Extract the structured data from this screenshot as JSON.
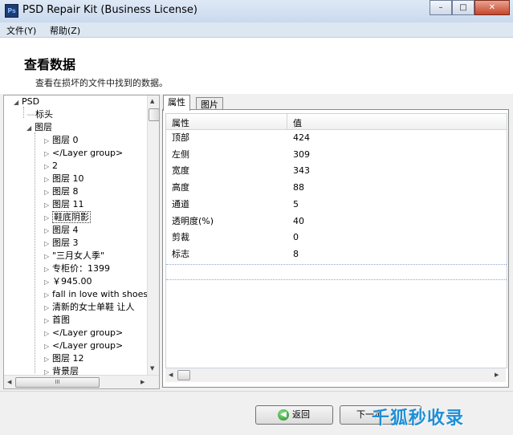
{
  "window": {
    "title": "PSD Repair Kit (Business License)",
    "app_icon_text": "Ps",
    "minimize_glyph": "–",
    "maximize_glyph": "□",
    "close_glyph": "✕"
  },
  "menu": {
    "file": "文件(Y)",
    "help": "帮助(Z)"
  },
  "header": {
    "title": "查看数据",
    "subtitle": "查看在损坏的文件中找到的数据。"
  },
  "tree": {
    "root": "PSD",
    "header_node": "标头",
    "layers_node": "图层",
    "children": [
      "图层 0",
      "</Layer group>",
      "2",
      "图层 10",
      "图层 8",
      "图层 11",
      "鞋底阴影",
      "图层 4",
      "图层 3",
      "\"三月女人季\"",
      "专柜价：1399",
      "￥945.00",
      "fall in love with shoes",
      "清新的女士单鞋 让人",
      "首图",
      "</Layer group>",
      "</Layer group>",
      "图层 12",
      "背景层"
    ],
    "selected_index": 6,
    "hscroll_grip": "III"
  },
  "tabs": {
    "properties": "属性",
    "image": "图片"
  },
  "grid": {
    "headers": [
      "属性",
      "值"
    ],
    "rows": [
      [
        "顶部",
        "424"
      ],
      [
        "左侧",
        "309"
      ],
      [
        "宽度",
        "343"
      ],
      [
        "高度",
        "88"
      ],
      [
        "通道",
        "5"
      ],
      [
        "透明度(%)",
        "40"
      ],
      [
        "剪裁",
        "0"
      ],
      [
        "标志",
        "8"
      ]
    ]
  },
  "footer": {
    "back_label": "返回",
    "next_label": "下一步"
  },
  "watermark": "千狐秒收录",
  "colors": {
    "title_bar": "#c9d9ee",
    "menu_bar": "#dde7f2",
    "watermark": "#1f8fd6"
  }
}
